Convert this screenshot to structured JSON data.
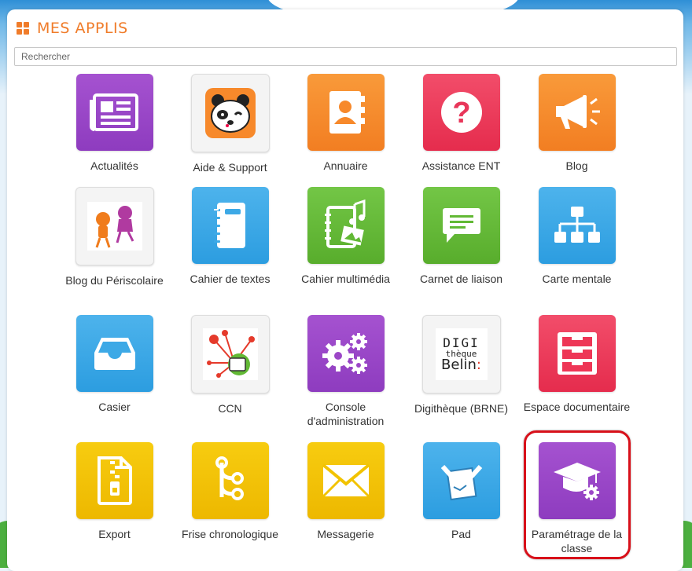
{
  "header": {
    "title": "MES APPLIS",
    "icon": "apps-grid-icon"
  },
  "search": {
    "placeholder": "Rechercher"
  },
  "apps": [
    {
      "label": "Actualités",
      "icon": "newspaper-icon",
      "color": "#9c47c7"
    },
    {
      "label": "Aide & Support",
      "icon": "panda-icon",
      "color": "#f5f5f5"
    },
    {
      "label": "Annuaire",
      "icon": "contact-book-icon",
      "color": "#f7892b"
    },
    {
      "label": "Assistance ENT",
      "icon": "question-icon",
      "color": "#ee3656"
    },
    {
      "label": "Blog",
      "icon": "megaphone-icon",
      "color": "#f7892b"
    },
    {
      "label": "Blog du Périscolaire",
      "icon": "children-icon",
      "color": "#f5f5f5"
    },
    {
      "label": "Cahier de textes",
      "icon": "notebook-icon",
      "color": "#3da9e6"
    },
    {
      "label": "Cahier multimédia",
      "icon": "multimedia-notebook-icon",
      "color": "#62b935"
    },
    {
      "label": "Carnet de liaison",
      "icon": "speech-bubble-icon",
      "color": "#62b935"
    },
    {
      "label": "Carte mentale",
      "icon": "sitemap-icon",
      "color": "#3da9e6"
    },
    {
      "label": "Casier",
      "icon": "inbox-tray-icon",
      "color": "#3da9e6"
    },
    {
      "label": "CCN",
      "icon": "network-icon",
      "color": "#f5f5f5"
    },
    {
      "label": "Console d'administration",
      "icon": "gears-icon",
      "color": "#9c47c7"
    },
    {
      "label": "Digithèque (BRNE)",
      "icon": "digitheque-logo",
      "color": "#f5f5f5"
    },
    {
      "label": "Espace documentaire",
      "icon": "drawers-icon",
      "color": "#ee3656"
    },
    {
      "label": "Export",
      "icon": "zip-file-icon",
      "color": "#f2c300"
    },
    {
      "label": "Frise chronologique",
      "icon": "timeline-icon",
      "color": "#f2c300"
    },
    {
      "label": "Messagerie",
      "icon": "envelope-icon",
      "color": "#f2c300"
    },
    {
      "label": "Pad",
      "icon": "pad-icon",
      "color": "#3da9e6"
    },
    {
      "label": "Paramétrage de la classe",
      "icon": "graduation-cap-gear-icon",
      "color": "#9c47c7"
    }
  ],
  "logo_text": {
    "line1": "DIGI",
    "line2": "thèque",
    "line3": "Belin"
  }
}
